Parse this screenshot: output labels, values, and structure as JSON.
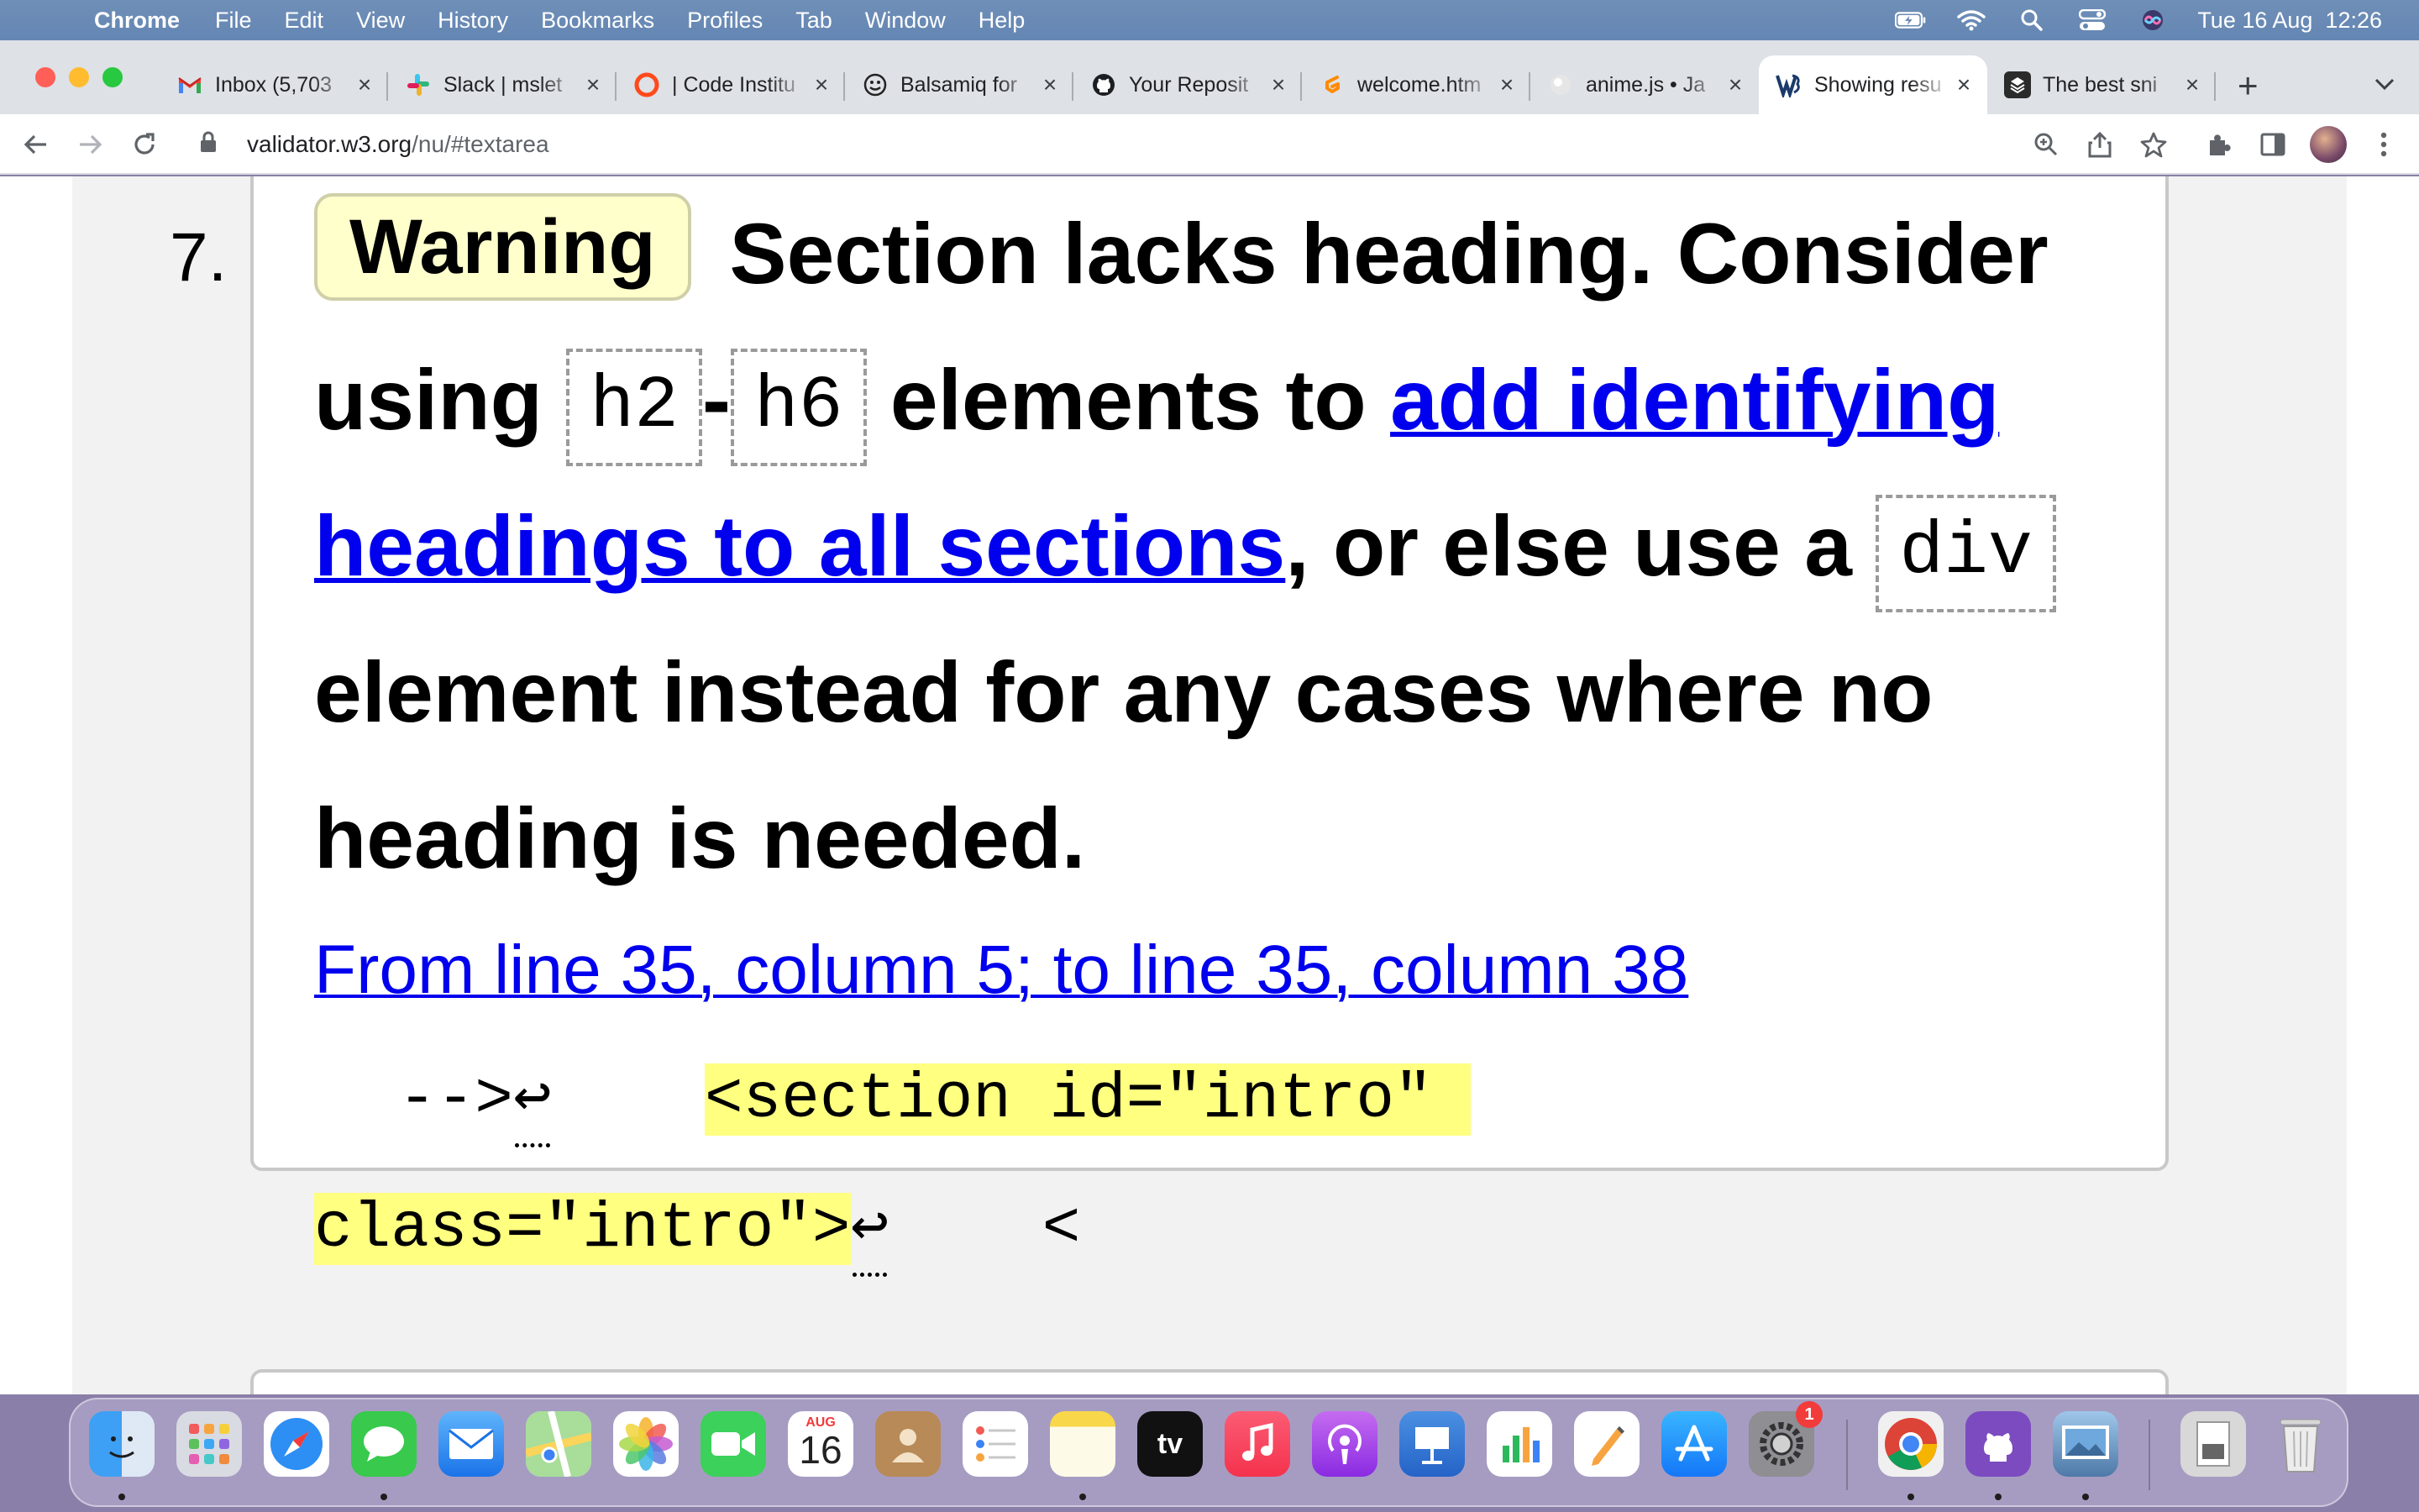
{
  "menubar": {
    "app_name": "Chrome",
    "items": [
      "File",
      "Edit",
      "View",
      "History",
      "Bookmarks",
      "Profiles",
      "Tab",
      "Window",
      "Help"
    ],
    "clock": "Tue 16 Aug  12:26"
  },
  "tabs": [
    {
      "title": "Inbox (5,703",
      "icon": "gmail-icon"
    },
    {
      "title": "Slack | mslet",
      "icon": "slack-icon"
    },
    {
      "title": "| Code Institu",
      "icon": "code-institute-icon"
    },
    {
      "title": "Balsamiq for",
      "icon": "balsamiq-icon"
    },
    {
      "title": "Your Reposit",
      "icon": "github-icon"
    },
    {
      "title": "welcome.htm",
      "icon": "gitpod-icon"
    },
    {
      "title": "anime.js • Ja",
      "icon": "animejs-icon"
    },
    {
      "title": "Showing resu",
      "icon": "w3c-validator-icon",
      "active": true
    },
    {
      "title": "The best sni",
      "icon": "snippet-icon"
    }
  ],
  "address_bar": {
    "host": "validator.w3.org",
    "path": "/nu/#textarea"
  },
  "message": {
    "number": "7.",
    "type_label": "Warning",
    "text_1": "Section lacks heading. Consider using",
    "code_1": "h2",
    "dash": "-",
    "code_2": "h6",
    "text_2": "elements to",
    "link_text": "add identifying headings to all sections",
    "text_3": ", or else use a",
    "code_3": "div",
    "text_4": "element instead for any cases where no heading is needed.",
    "location": "From line 35, column 5; to line 35, column 38",
    "extract": {
      "line1_pre": "-->",
      "lf_symbol": "↩",
      "gap1": "    ",
      "line1_highlight": "<section id=\"intro\" ",
      "line2_highlight": "class=\"intro\">",
      "gap2": "    ",
      "line2_post": "<"
    }
  },
  "dock": {
    "calendar_month": "AUG",
    "calendar_day": "16",
    "settings_badge": "1",
    "tv_label": "tv"
  }
}
